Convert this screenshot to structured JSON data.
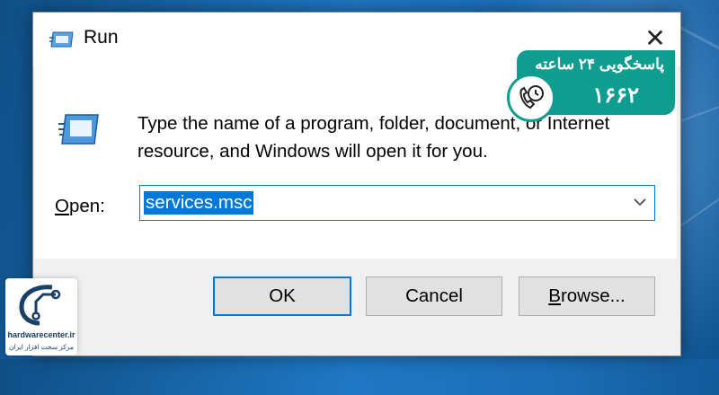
{
  "window": {
    "title": "Run",
    "close_glyph": "✕"
  },
  "dialog": {
    "description": "Type the name of a program, folder, document, or Internet resource, and Windows will open it for you.",
    "open_label_prefix": "O",
    "open_label_rest": "pen:",
    "input_value": "services.msc",
    "dropdown_icon": "chevron-down-icon"
  },
  "buttons": {
    "ok": "OK",
    "cancel": "Cancel",
    "browse_prefix": "B",
    "browse_rest": "rowse..."
  },
  "badge": {
    "line1": "پاسخگویی ۲۴ ساعته",
    "phone": "۱۶۶۲",
    "icon": "phone-clock-icon"
  },
  "logo": {
    "site": "hardwarecenter.ir",
    "tagline": "مرکز سخت افزار ایران",
    "icon": "circuit-logo-icon"
  },
  "colors": {
    "accent": "#0078d7",
    "badge": "#0f9d8f",
    "desktop": "#1f78c4"
  }
}
